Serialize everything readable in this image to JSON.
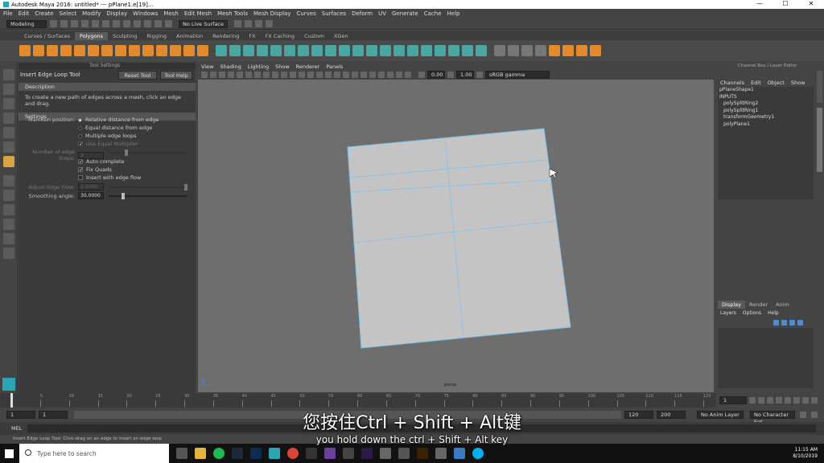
{
  "window": {
    "title": "Autodesk Maya 2016: untitled*   ---   pPlane1.e[19]...",
    "controls": [
      "—",
      "☐",
      "✕"
    ]
  },
  "menubar": [
    "File",
    "Edit",
    "Create",
    "Select",
    "Modify",
    "Display",
    "Windows",
    "Mesh",
    "Edit Mesh",
    "Mesh Tools",
    "Mesh Display",
    "Curves",
    "Surfaces",
    "Deform",
    "UV",
    "Generate",
    "Cache",
    "Help"
  ],
  "statusline": {
    "mode": "Modeling",
    "live_surface": "No Live Surface"
  },
  "shelf_tabs": [
    "Curves / Surfaces",
    "Polygons",
    "Sculpting",
    "Rigging",
    "Animation",
    "Rendering",
    "FX",
    "FX Caching",
    "Custom",
    "XGen"
  ],
  "active_shelf_tab": "Polygons",
  "tool_settings": {
    "header": "Tool Settings",
    "tool_name": "Insert Edge Loop Tool",
    "reset_button": "Reset Tool",
    "help_button": "Tool Help",
    "description_title": "Description",
    "description": "To create a new path of edges across a mesh, click an edge and drag.",
    "settings_title": "Settings",
    "maintain_position_label": "Maintain position:",
    "options": [
      "Relative distance from edge",
      "Equal distance from edge",
      "Multiple edge loops"
    ],
    "use_equal_multiplier": "Use Equal Multiplier",
    "number_of_edge_loops_label": "Number of edge loops:",
    "number_of_edge_loops": "2",
    "auto_complete": "Auto complete",
    "fix_quads": "Fix Quads",
    "insert_with_edge_flow": "Insert with edge flow",
    "adjust_edge_flow_label": "Adjust Edge Flow:",
    "adjust_edge_flow": "1.0000",
    "smoothing_angle_label": "Smoothing angle:",
    "smoothing_angle": "30.0000"
  },
  "viewport": {
    "menu": [
      "View",
      "Shading",
      "Lighting",
      "Show",
      "Renderer",
      "Panels"
    ],
    "field_a": "0.00",
    "field_b": "1.00",
    "color_space": "sRGB gamma",
    "camera": "persp"
  },
  "channel_box": {
    "header": "Channel Box / Layer Editor",
    "menu": [
      "Channels",
      "Edit",
      "Object",
      "Show"
    ],
    "object": "pPlaneShape1",
    "inputs_label": "INPUTS",
    "inputs": [
      "polySplitRing2",
      "polySplitRing1",
      "transformGeometry1",
      "polyPlane1"
    ]
  },
  "layer_editor": {
    "tabs": [
      "Display",
      "Render",
      "Anim"
    ],
    "menu": [
      "Layers",
      "Options",
      "Help"
    ]
  },
  "timeline": {
    "ticks": [
      "1",
      "5",
      "10",
      "15",
      "20",
      "25",
      "30",
      "35",
      "40",
      "45",
      "50",
      "55",
      "60",
      "65",
      "70",
      "75",
      "80",
      "85",
      "90",
      "95",
      "100",
      "105",
      "110",
      "115",
      "120"
    ],
    "current": "1"
  },
  "range": {
    "start": "1",
    "start2": "1",
    "end": "120",
    "end2": "120",
    "end3": "200",
    "anim_layer": "No Anim Layer",
    "character_set": "No Character Set"
  },
  "cmdline": {
    "label": "MEL"
  },
  "helpline": "Insert Edge Loop Tool: Click-drag on an edge to insert an edge loop",
  "taskbar": {
    "search": "Type here to search",
    "time": "11:15 AM",
    "date": "8/10/2019"
  },
  "subtitles": {
    "zh": "您按住Ctrl + Shift + Alt键",
    "en": "you hold down the ctrl + Shift + Alt key"
  },
  "colors": {
    "accent_orange": "#e38b2b",
    "wire_blue": "#7ec4ee",
    "viewport_bg": "#6e6e6e",
    "plane": "#c4c4c4"
  }
}
